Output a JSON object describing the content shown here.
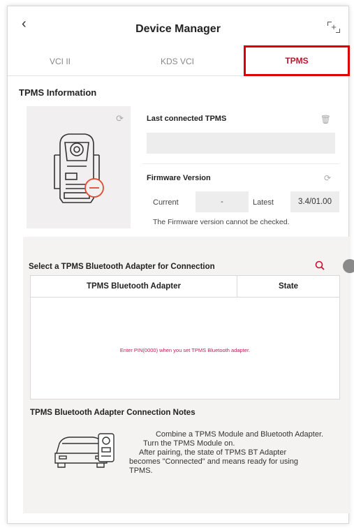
{
  "header": {
    "back_icon": "chevron-left-icon",
    "title": "Device Manager",
    "right_icon": "scan-frame-icon"
  },
  "tabs": [
    {
      "label": "VCI II",
      "active": false
    },
    {
      "label": "KDS VCI",
      "active": false
    },
    {
      "label": "TPMS",
      "active": true
    }
  ],
  "tpms_info": {
    "section_title": "TPMS Information",
    "last_connected_label": "Last connected TPMS",
    "last_connected_value": "",
    "firmware_label": "Firmware Version",
    "current_label": "Current",
    "current_value": "-",
    "latest_label": "Latest",
    "latest_value": "3.4/01.00",
    "firmware_note": "The Firmware version cannot be checked."
  },
  "adapter_select": {
    "title": "Select a TPMS Bluetooth Adapter for Connection",
    "columns": [
      "TPMS Bluetooth Adapter",
      "State"
    ],
    "empty_message": "Enter PIN(0000) when you set TPMS Bluetooth adapter."
  },
  "notes": {
    "title": "TPMS Bluetooth Adapter Connection Notes",
    "line1": "Combine a TPMS Module and Bluetooth Adapter.",
    "line2": "Turn the TPMS Module on.",
    "line3": "After pairing, the state of TPMS BT Adapter",
    "line4": "becomes \"Connected\" and means ready for using",
    "line5": "TPMS."
  },
  "colors": {
    "accent": "#c8102e",
    "tab_highlight_border": "#e00000",
    "pin_text": "#c2185b"
  }
}
